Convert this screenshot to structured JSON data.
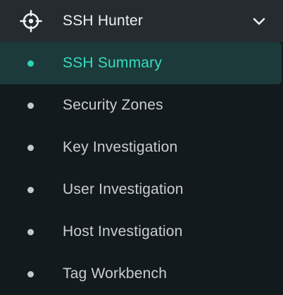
{
  "header": {
    "title": "SSH Hunter",
    "icon": "crosshair-icon",
    "toggle_icon": "chevron-down-icon"
  },
  "nav": {
    "items": [
      {
        "label": "SSH Summary",
        "active": true
      },
      {
        "label": "Security Zones",
        "active": false
      },
      {
        "label": "Key Investigation",
        "active": false
      },
      {
        "label": "User Investigation",
        "active": false
      },
      {
        "label": "Host Investigation",
        "active": false
      },
      {
        "label": "Tag Workbench",
        "active": false
      }
    ]
  },
  "colors": {
    "background": "#131a1e",
    "header_background": "#262b2f",
    "active_background": "#1c3a3a",
    "accent": "#39dcc0",
    "text": "#c9ced2"
  }
}
